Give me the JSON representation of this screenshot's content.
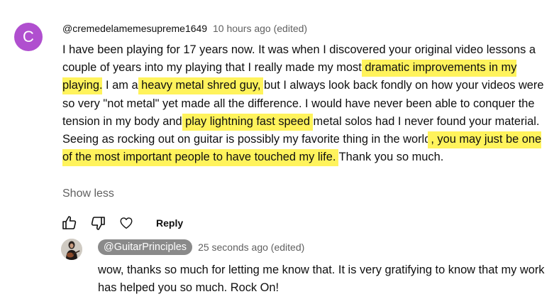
{
  "comment": {
    "avatar_letter": "C",
    "avatar_color": "#b04fcf",
    "author": "@cremedelamemesupreme1649",
    "time": "10 hours ago (edited)",
    "body": [
      {
        "text": "I have been playing for 17 years now. It was when I discovered your original video lessons a couple of years into my playing that I really made my most ",
        "highlight": false
      },
      {
        "text": "dramatic improvements in my playing",
        "highlight": true
      },
      {
        "text": ". I am a ",
        "highlight": false
      },
      {
        "text": "heavy metal shred guy,",
        "highlight": true
      },
      {
        "text": " but I always look back fondly on how your videos were so very \"not metal\" yet made all the difference. I would have never been able to conquer the tension in my body and ",
        "highlight": false
      },
      {
        "text": "play lightning fast speed",
        "highlight": true
      },
      {
        "text": " metal solos had I never found your material. Seeing as rocking out on guitar is possibly my favorite thing in the world",
        "highlight": false
      },
      {
        "text": ", you may just be one of the most important people to have touched my life.",
        "highlight": true
      },
      {
        "text": " Thank you so much.",
        "highlight": false
      }
    ],
    "show_less": "Show less",
    "actions": {
      "like_icon": "thumbs-up-icon",
      "dislike_icon": "thumbs-down-icon",
      "heart_icon": "heart-icon",
      "reply_label": "Reply"
    }
  },
  "reply": {
    "author": "@GuitarPrinciples",
    "time": "25 seconds ago (edited)",
    "body": "wow, thanks so much for letting me know that. It is very gratifying to know that my work has helped you so much. Rock On!"
  },
  "colors": {
    "highlight": "#fff35c",
    "meta_text": "#606060",
    "channel_badge": "#8a8a8a"
  }
}
